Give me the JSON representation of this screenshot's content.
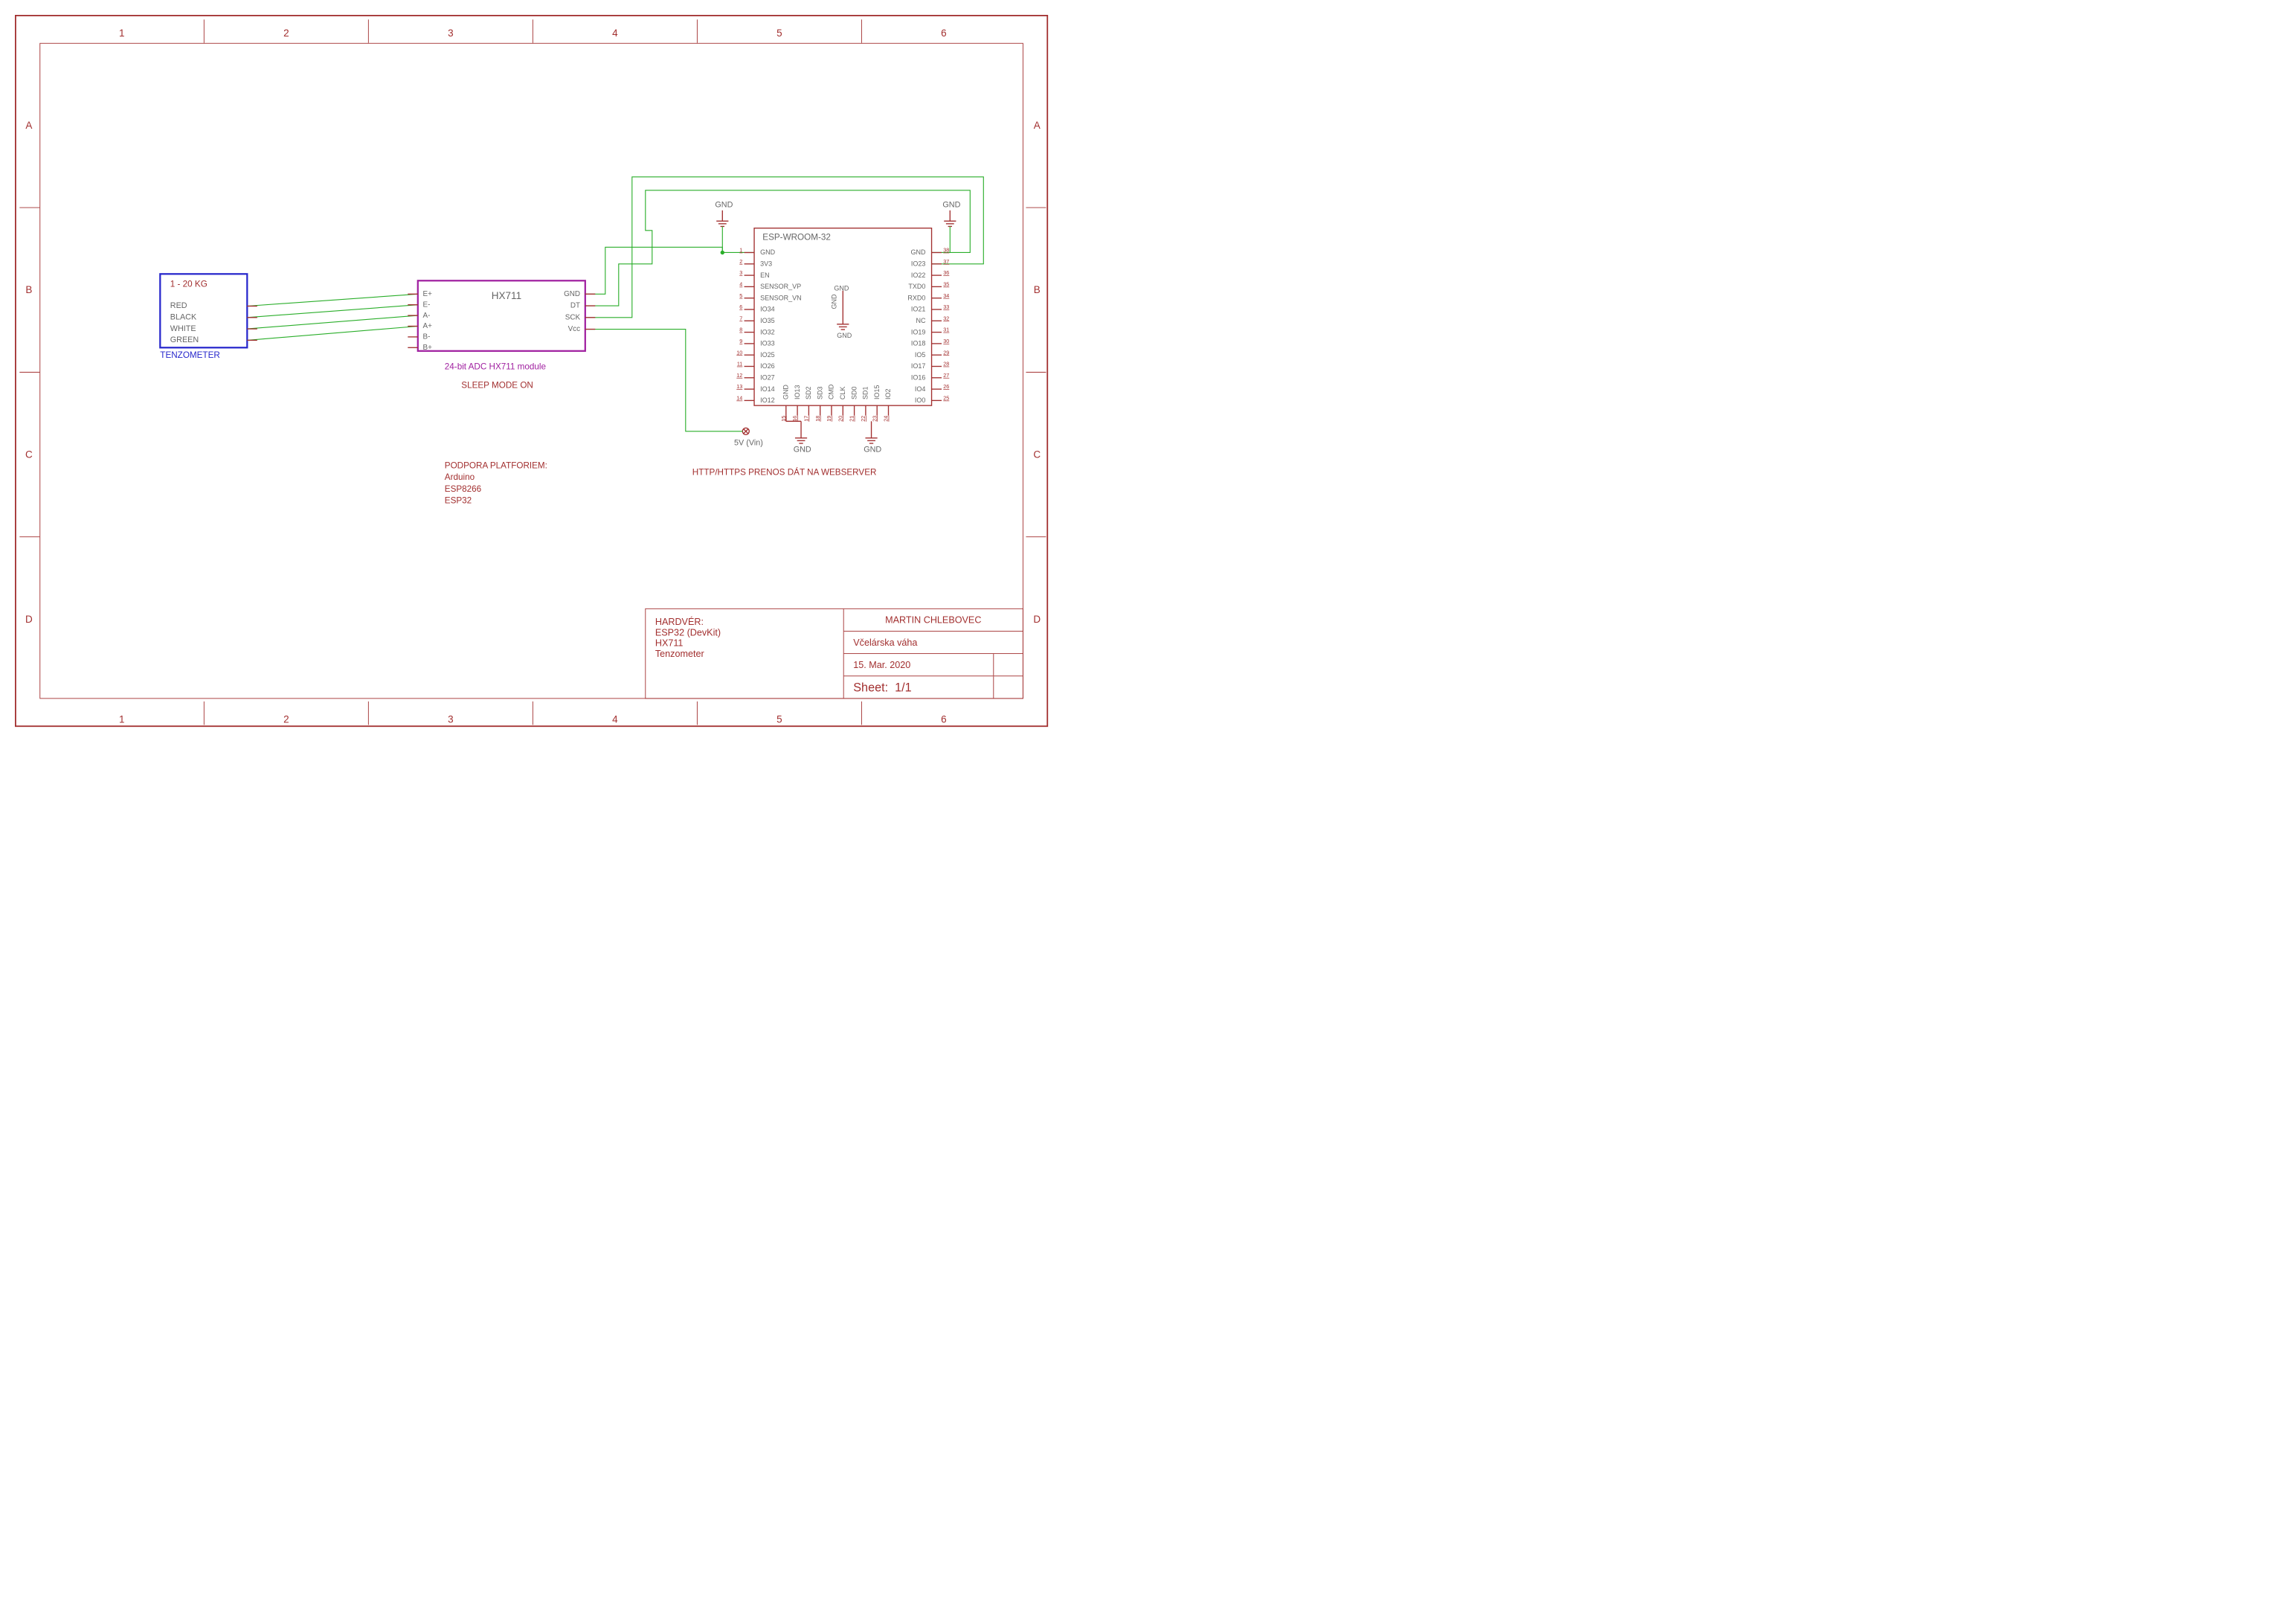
{
  "frame": {
    "cols": [
      "1",
      "2",
      "3",
      "4",
      "5",
      "6"
    ],
    "rows": [
      "A",
      "B",
      "C",
      "D"
    ]
  },
  "tenzometer": {
    "title": "1 - 20 KG",
    "pins": [
      "RED",
      "BLACK",
      "WHITE",
      "GREEN"
    ],
    "label": "TENZOMETER"
  },
  "hx711": {
    "name": "HX711",
    "left_pins": [
      "E+",
      "E-",
      "A-",
      "A+",
      "B-",
      "B+"
    ],
    "right_pins": [
      "GND",
      "DT",
      "SCK",
      "Vcc"
    ],
    "sub1": "24-bit ADC HX711 module",
    "sub2": "SLEEP MODE ON"
  },
  "esp": {
    "name": "ESP-WROOM-32",
    "left_pins": [
      "GND",
      "3V3",
      "EN",
      "SENSOR_VP",
      "SENSOR_VN",
      "IO34",
      "IO35",
      "IO32",
      "IO33",
      "IO25",
      "IO26",
      "IO27",
      "IO14",
      "IO12"
    ],
    "right_pins": [
      "GND",
      "IO23",
      "IO22",
      "TXD0",
      "RXD0",
      "IO21",
      "NC",
      "IO19",
      "IO18",
      "IO5",
      "IO17",
      "IO16",
      "IO4",
      "IO0"
    ],
    "bottom_pins": [
      "GND",
      "IO13",
      "SD2",
      "SD3",
      "CMD",
      "CLK",
      "SD0",
      "SD1",
      "IO15",
      "IO2"
    ],
    "left_nums": [
      "1",
      "2",
      "3",
      "4",
      "5",
      "6",
      "7",
      "8",
      "9",
      "10",
      "11",
      "12",
      "13",
      "14"
    ],
    "right_nums": [
      "38",
      "37",
      "36",
      "35",
      "34",
      "33",
      "32",
      "31",
      "30",
      "29",
      "28",
      "27",
      "26",
      "25"
    ],
    "bottom_nums": [
      "15",
      "16",
      "17",
      "18",
      "19",
      "20",
      "21",
      "22",
      "23",
      "24"
    ],
    "inner_gnd": "GND",
    "vin": "5V (Vin)",
    "gnd": "GND"
  },
  "captions": {
    "platforms_title": "PODPORA PLATFORIEM:",
    "platforms": [
      "Arduino",
      "ESP8266",
      "ESP32"
    ],
    "http": "HTTP/HTTPS PRENOS DÁT NA WEBSERVER"
  },
  "title_block": {
    "hardware_title": "HARDVÉR:",
    "hardware": [
      "ESP32 (DevKit)",
      "HX711",
      "Tenzometer"
    ],
    "author": "MARTIN CHLEBOVEC",
    "project": "Včelárska váha",
    "date": "15. Mar. 2020",
    "sheet_label": "Sheet:",
    "sheet_value": "1/1"
  }
}
